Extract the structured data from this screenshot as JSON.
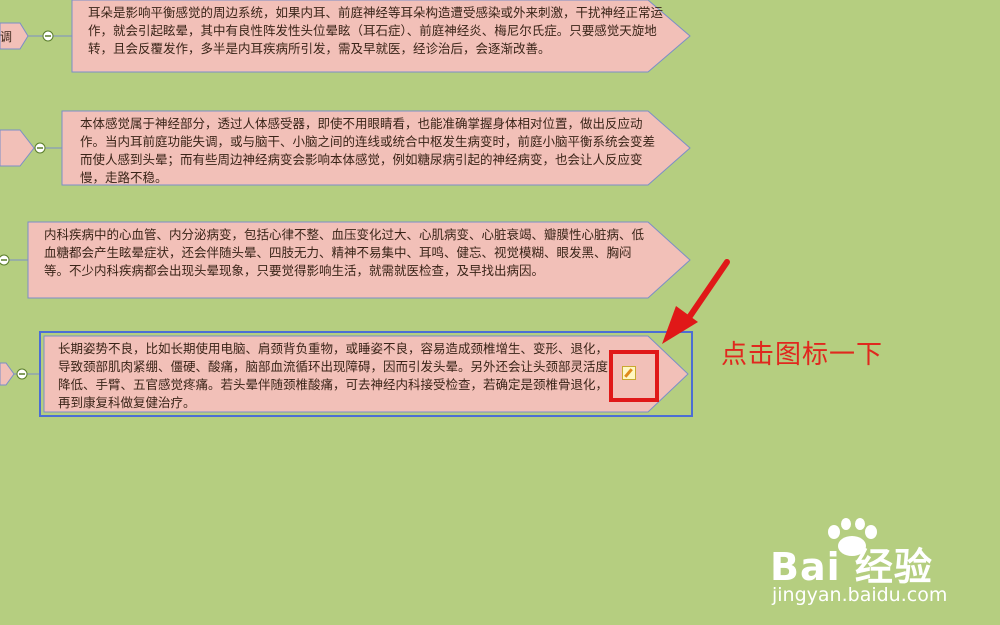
{
  "mindmap": {
    "nodes": [
      {
        "text": "耳朵是影响平衡感觉的周边系统，如果内耳、前庭神经等耳朵构造遭受感染或外来刺激，干扰神经正常运作，就会引起眩晕，其中有良性阵发性头位晕眩（耳石症）、前庭神经炎、梅尼尔氏症。只要感觉天旋地转，且会反覆发作，多半是内耳疾病所引发，需及早就医，经诊治后，会逐渐改善。"
      },
      {
        "text": "本体感觉属于神经部分，透过人体感受器，即使不用眼睛看，也能准确掌握身体相对位置，做出反应动作。当内耳前庭功能失调，或与脑干、小脑之间的连线或统合中枢发生病变时，前庭小脑平衡系统会变差而使人感到头晕；而有些周边神经病变会影响本体感觉，例如糖尿病引起的神经病变，也会让人反应变慢，走路不稳。"
      },
      {
        "text": "内科疾病中的心血管、内分泌病变，包括心律不整、血压变化过大、心肌病变、心脏衰竭、瓣膜性心脏病、低血糖都会产生眩晕症状，还会伴随头晕、四肢无力、精神不易集中、耳鸣、健忘、视觉模糊、眼发黑、胸闷等。不少内科疾病都会出现头晕现象，只要觉得影响生活，就需就医检查，及早找出病因。"
      },
      {
        "text": "长期姿势不良，比如长期使用电脑、肩颈背负重物，或睡姿不良，容易造成颈椎增生、变形、退化，导致颈部肌肉紧绷、僵硬、酸痛，脑部血流循环出现障碍，因而引发头晕。另外还会让头颈部灵活度降低、手臂、五官感觉疼痛。若头晕伴随颈椎酸痛，可去神经内科接受检查，若确定是颈椎骨退化，再到康复科做复健治疗。"
      }
    ],
    "left_stub_text": "调"
  },
  "annotation": {
    "text": "点击图标一下"
  },
  "watermark": {
    "brand": "Bai 经验",
    "url": "jingyan.baidu.com"
  },
  "colors": {
    "background": "#b5ce80",
    "node_fill": "#f2c0b8",
    "node_stroke": "#7a8ec8",
    "annotation": "#e0281e"
  },
  "icons": [
    "collapse-minus-icon",
    "edit-note-icon",
    "red-arrow-icon",
    "baidu-paw-icon"
  ]
}
